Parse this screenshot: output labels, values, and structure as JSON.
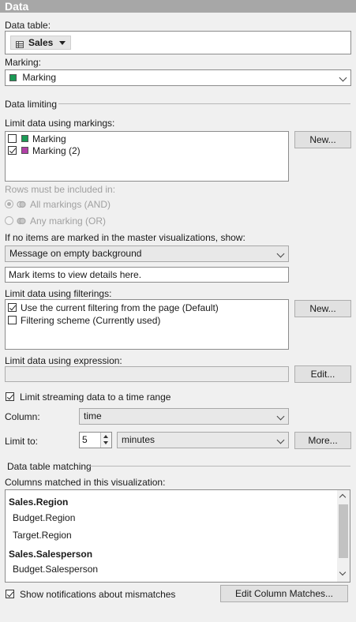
{
  "header": {
    "title": "Data"
  },
  "data_table": {
    "label": "Data table:",
    "value": "Sales"
  },
  "marking": {
    "label": "Marking:",
    "value": "Marking",
    "color": "#1a9a55"
  },
  "data_limiting": {
    "label": "Data limiting"
  },
  "markings_limit": {
    "label": "Limit data using markings:",
    "items": [
      {
        "label": "Marking",
        "checked": false,
        "color": "#1a9a55"
      },
      {
        "label": "Marking (2)",
        "checked": true,
        "color": "#b13fa6"
      }
    ],
    "new_button": "New..."
  },
  "rows_included": {
    "label": "Rows must be included in:",
    "options": [
      {
        "label": "All markings (AND)",
        "selected": true
      },
      {
        "label": "Any marking (OR)",
        "selected": false
      }
    ]
  },
  "empty_master": {
    "label": "If no items are marked in the master visualizations, show:",
    "select_value": "Message on empty background",
    "message_value": "Mark items to view details here."
  },
  "filterings_limit": {
    "label": "Limit data using filterings:",
    "items": [
      {
        "label": "Use the current filtering from the page (Default)",
        "checked": true
      },
      {
        "label": "Filtering scheme (Currently used)",
        "checked": false
      }
    ],
    "new_button": "New..."
  },
  "expression_limit": {
    "label": "Limit data using expression:",
    "value": "",
    "edit_button": "Edit..."
  },
  "streaming": {
    "label": "Limit streaming data to a time range",
    "checked": true
  },
  "column": {
    "label": "Column:",
    "value": "time"
  },
  "limit_to": {
    "label": "Limit to:",
    "number": "5",
    "unit": "minutes",
    "more_button": "More..."
  },
  "table_matching": {
    "label": "Data table matching"
  },
  "columns_matched": {
    "label": "Columns matched in this visualization:",
    "groups": [
      {
        "title": "Sales.Region",
        "items": [
          "Budget.Region",
          "Target.Region"
        ]
      },
      {
        "title": "Sales.Salesperson",
        "items": [
          "Budget.Salesperson"
        ]
      }
    ]
  },
  "notifications": {
    "label": "Show notifications about mismatches",
    "checked": true
  },
  "edit_matches_button": "Edit Column Matches...",
  "colors": {
    "header_bg": "#a7a7a7",
    "panel_bg": "#f0f0f0"
  }
}
